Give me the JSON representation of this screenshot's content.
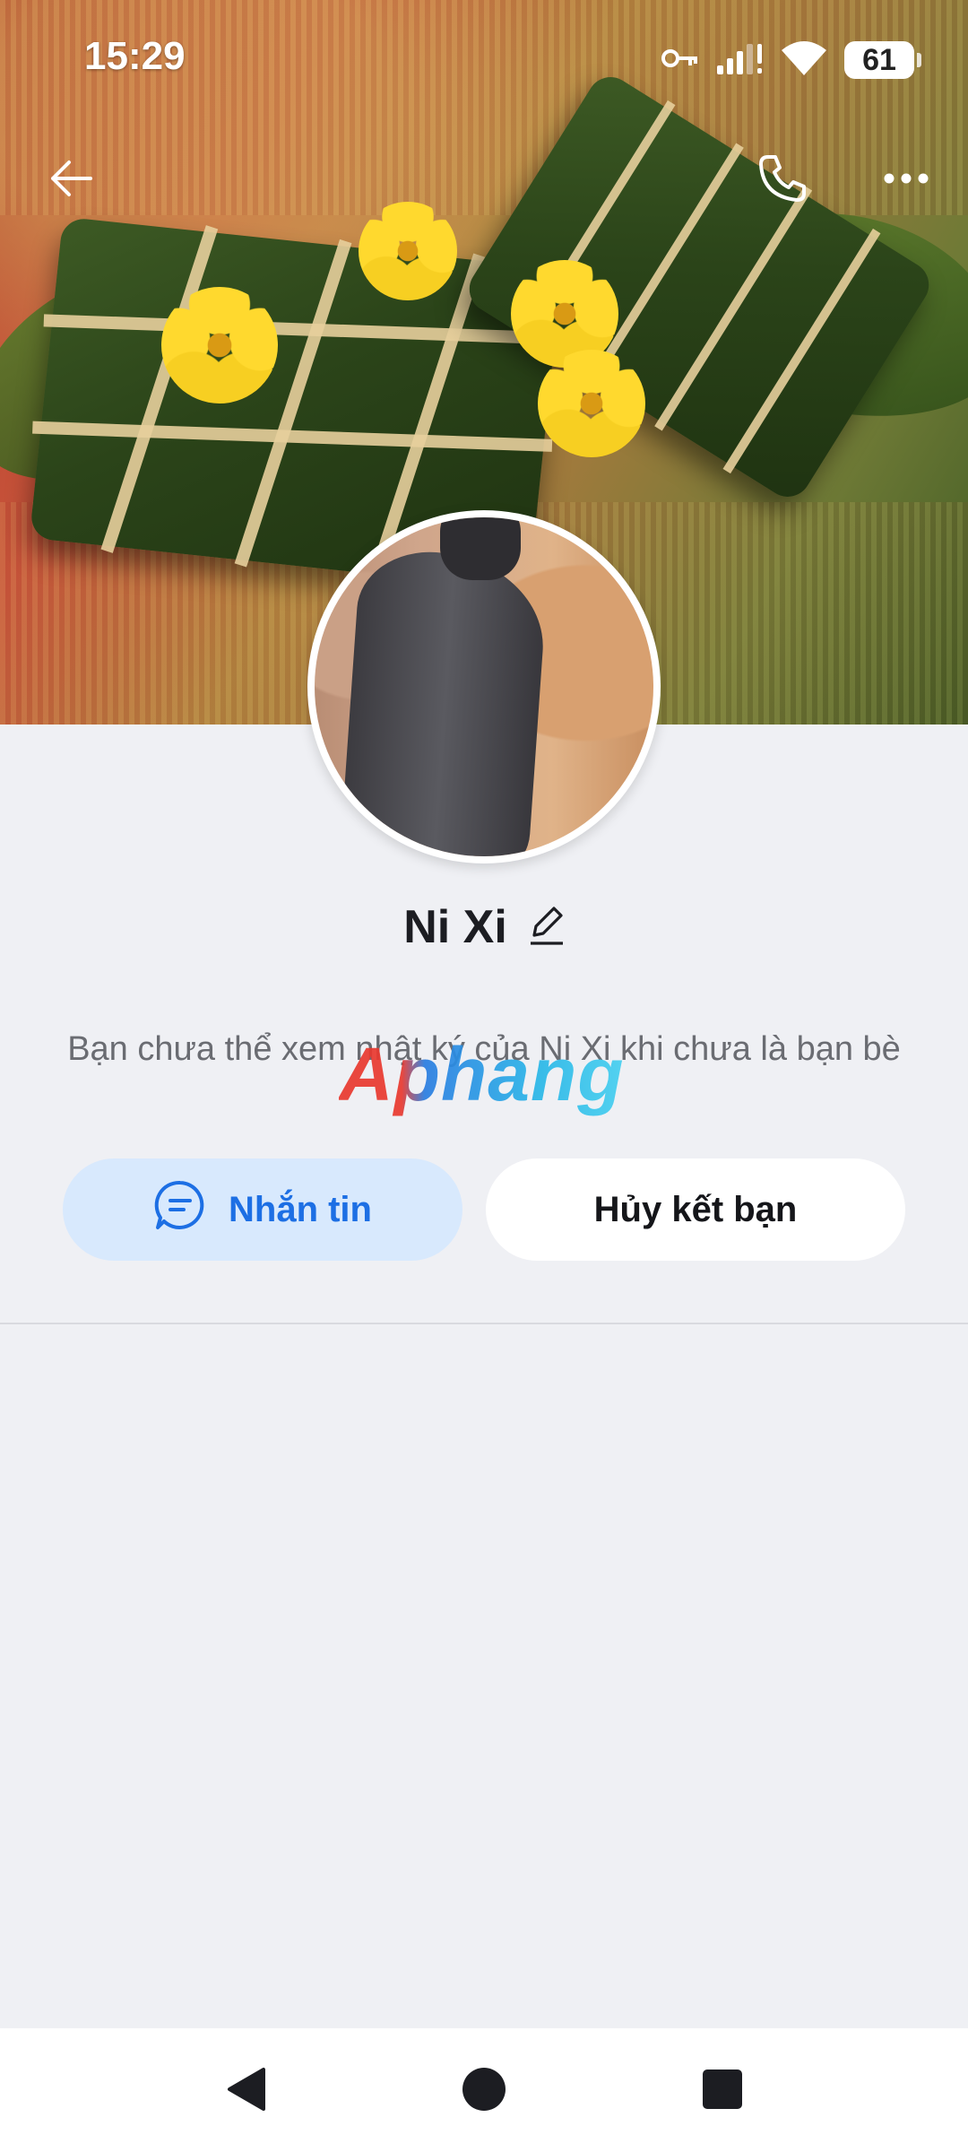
{
  "status_bar": {
    "time": "15:29",
    "battery": "61"
  },
  "profile": {
    "name": "Ni Xi",
    "notice": "Bạn chưa thể xem nhật ký của Ni Xi khi chưa là bạn bè"
  },
  "watermark": "Aphang",
  "actions": {
    "message_label": "Nhắn tin",
    "unfriend_label": "Hủy kết bạn"
  },
  "icons": {
    "back": "arrow-left-icon",
    "call": "phone-icon",
    "more": "more-horizontal-icon",
    "edit": "pencil-icon",
    "message": "chat-bubble-icon",
    "key": "key-icon",
    "signal": "signal-icon",
    "wifi": "wifi-icon",
    "nav_back": "triangle-back-icon",
    "nav_home": "circle-home-icon",
    "nav_recents": "square-recents-icon"
  },
  "colors": {
    "accent": "#1d6fe4",
    "accent_bg": "#d8e9fd",
    "page_bg": "#eff0f4"
  }
}
